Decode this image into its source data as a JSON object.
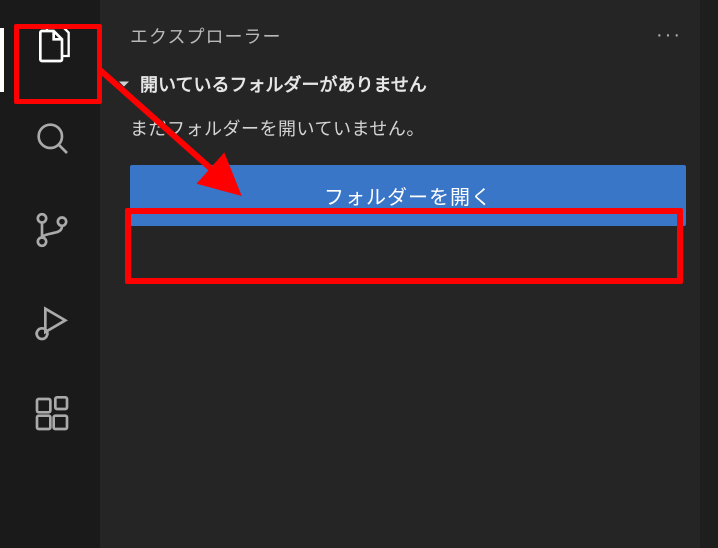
{
  "sidebar": {
    "title": "エクスプローラー",
    "moreActions": "···",
    "section": {
      "title": "開いているフォルダーがありません",
      "message": "まだフォルダーを開いていません。",
      "openFolderLabel": "フォルダーを開く"
    }
  },
  "activityBar": {
    "items": [
      {
        "name": "explorer",
        "active": true
      },
      {
        "name": "search",
        "active": false
      },
      {
        "name": "source-control",
        "active": false
      },
      {
        "name": "run-debug",
        "active": false
      },
      {
        "name": "extensions",
        "active": false
      }
    ]
  },
  "annotations": {
    "highlightColor": "#ff0000"
  }
}
